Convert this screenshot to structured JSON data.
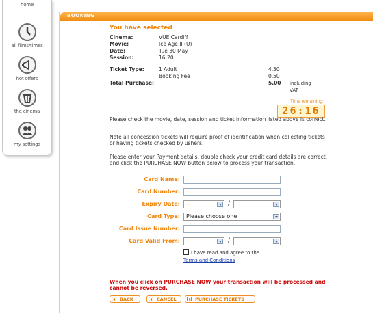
{
  "nav": {
    "items": [
      {
        "label": "home",
        "icon": "home-icon"
      },
      {
        "label": "all films/times",
        "icon": "clock-icon"
      },
      {
        "label": "hot offers",
        "icon": "megaphone-icon"
      },
      {
        "label": "the cinema",
        "icon": "popcorn-icon"
      },
      {
        "label": "my settings",
        "icon": "people-icon"
      }
    ]
  },
  "panel": {
    "title": "BOOKING"
  },
  "selection": {
    "heading": "You have selected",
    "cinema_label": "Cinema:",
    "cinema": "VUE Cardiff",
    "movie_label": "Movie:",
    "movie": "Ice Age II (U)",
    "date_label": "Date:",
    "date": "Tue 30 May",
    "session_label": "Session:",
    "session": "16:20",
    "ticket_type_label": "Ticket Type:",
    "ticket_type": "1 Adult",
    "ticket_price": "4.50",
    "booking_fee_label": "Booking Fee",
    "booking_fee": "0.50",
    "total_label": "Total Purchase:",
    "total": "5.00",
    "total_note": "including VAT"
  },
  "timer": {
    "label": "Time remaining:",
    "value": "26:16"
  },
  "info": {
    "p1": "Please check the movie, date, session and ticket information listed above is correct.",
    "p2": "Note all concession tickets will require proof of identification when collecting tickets or having tickets checked by ushers.",
    "p3": "Please enter your Payment details, double check your credit card details are correct, and click the PURCHASE NOW button below to process your transaction."
  },
  "form": {
    "card_name_label": "Card Name:",
    "card_number_label": "Card Number:",
    "expiry_label": "Expiry Date:",
    "expiry_month": "-",
    "expiry_year": "-",
    "card_type_label": "Card Type:",
    "card_type_value": "Please choose one",
    "issue_number_label": "Card Issue Number:",
    "valid_from_label": "Card Valid From:",
    "valid_month": "-",
    "valid_year": "-",
    "date_separator": "/",
    "agree_text": "I have read and agree to the",
    "terms_link": "Terms and Conditions"
  },
  "warning": "When you click on PURCHASE NOW your transaction will be processed and cannot be reversed.",
  "buttons": {
    "back": "BACK",
    "cancel": "CANCEL",
    "purchase": "PURCHASE TICKETS"
  },
  "colors": {
    "accent": "#f0860f",
    "warning": "#cc1111",
    "link": "#1a3fa8"
  }
}
